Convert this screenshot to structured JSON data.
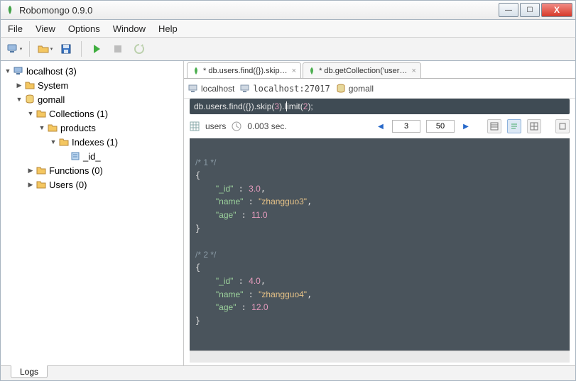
{
  "window": {
    "title": "Robomongo 0.9.0",
    "buttons": {
      "min": "—",
      "max": "☐",
      "close": "X"
    }
  },
  "menu": {
    "file": "File",
    "view": "View",
    "options": "Options",
    "window": "Window",
    "help": "Help"
  },
  "toolbar_icons": [
    "monitor",
    "open",
    "save",
    "run",
    "stop",
    "refresh"
  ],
  "tree": {
    "root": {
      "label": "localhost (3)"
    },
    "system": {
      "label": "System"
    },
    "gomall": {
      "label": "gomall"
    },
    "collections": {
      "label": "Collections (1)"
    },
    "products": {
      "label": "products"
    },
    "indexes": {
      "label": "Indexes (1)"
    },
    "id_idx": {
      "label": "_id_"
    },
    "functions": {
      "label": "Functions (0)"
    },
    "users": {
      "label": "Users (0)"
    }
  },
  "tabs": [
    {
      "label": "* db.users.find({}).skip…",
      "active": true
    },
    {
      "label": "* db.getCollection('user…",
      "active": false
    }
  ],
  "crumbs": {
    "host": "localhost",
    "hostport": "localhost:27017",
    "db": "gomall"
  },
  "query": {
    "pre": "db.users.find({}).skip(",
    "arg1": "3",
    "mid": ").l",
    "after_cursor": "imit(",
    "arg2": "2",
    "end": ");"
  },
  "result": {
    "collection": "users",
    "time": "0.003 sec.",
    "page_from": "3",
    "page_size": "50"
  },
  "docs": [
    {
      "comment": "/* 1 */",
      "_id": "3.0",
      "name": "zhangguo3",
      "age": "11.0"
    },
    {
      "comment": "/* 2 */",
      "_id": "4.0",
      "name": "zhangguo4",
      "age": "12.0"
    }
  ],
  "bottom_tab": "Logs"
}
